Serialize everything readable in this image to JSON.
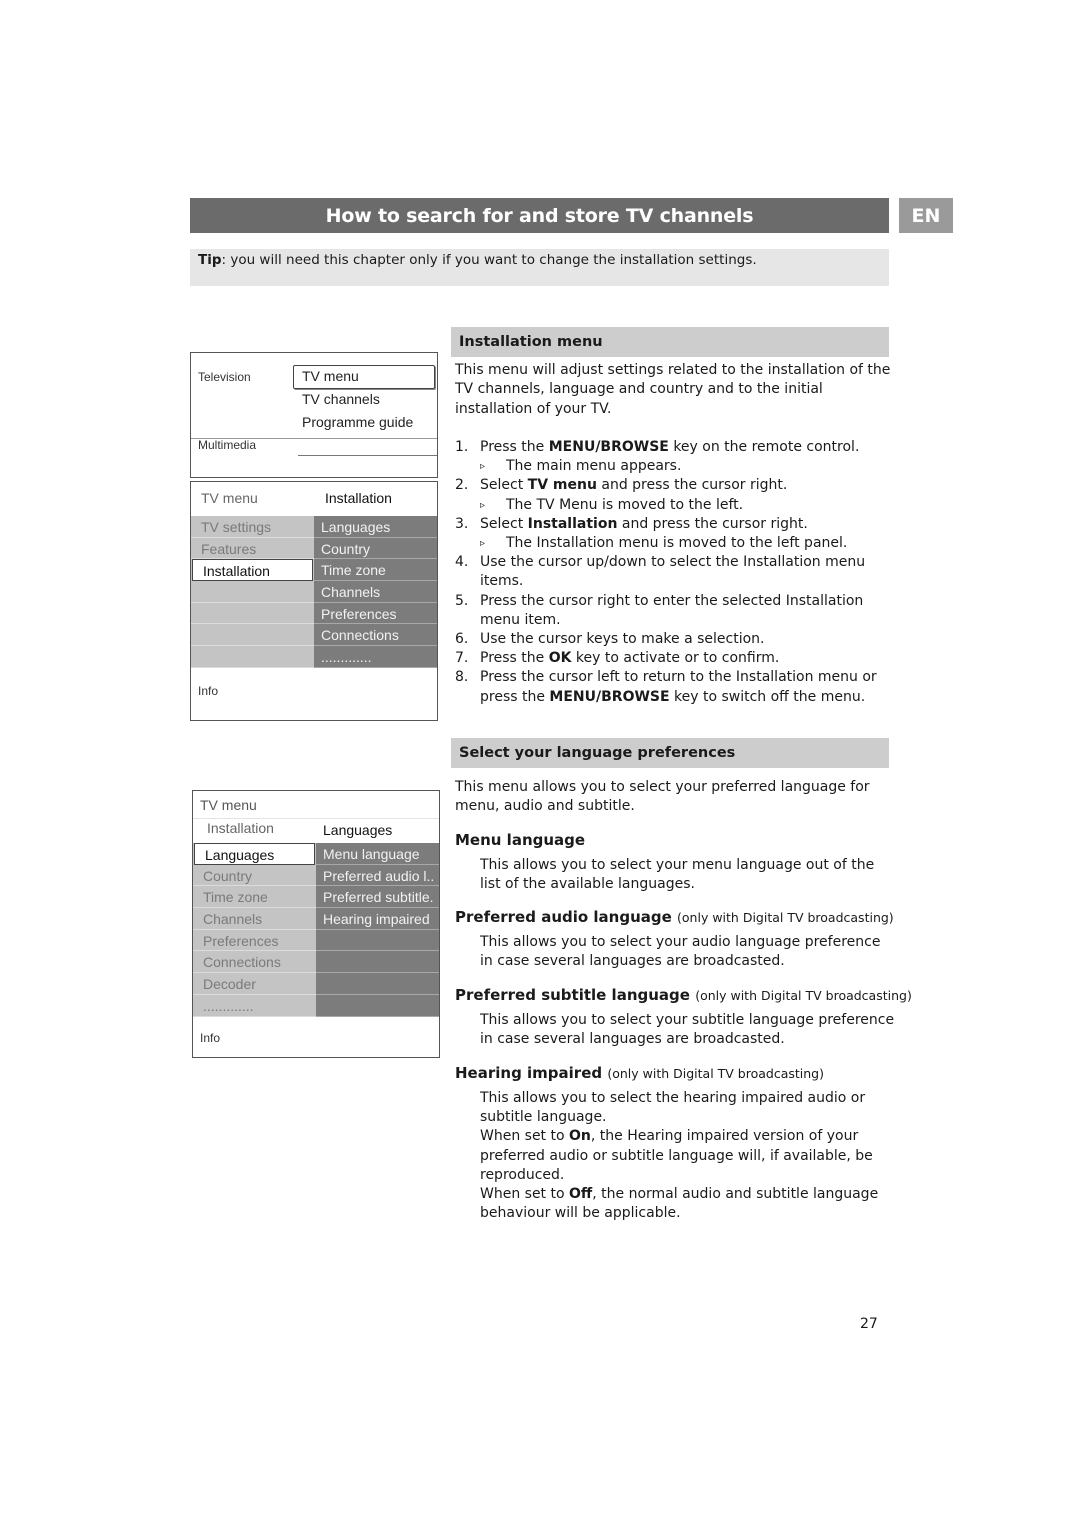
{
  "header": {
    "title": "How to search for and store TV channels",
    "lang_badge": "EN"
  },
  "tip": {
    "label": "Tip",
    "text": ": you will need this chapter only if you want to change the installation settings."
  },
  "menu_main": {
    "television_label": "Television",
    "multimedia_label": "Multimedia",
    "items": [
      "TV menu",
      "TV channels",
      "Programme guide"
    ]
  },
  "menu_installation": {
    "header_left": "TV menu",
    "header_right": "Installation",
    "left_items": [
      "TV settings",
      "Features",
      "Installation",
      "",
      "",
      "",
      ""
    ],
    "left_active": "Installation",
    "right_items": [
      "Languages",
      "Country",
      "Time zone",
      "Channels",
      "Preferences",
      "Connections",
      "............."
    ],
    "info": "Info"
  },
  "menu_languages": {
    "header_top": "TV menu",
    "header_left": "Installation",
    "header_right": "Languages",
    "left_items": [
      "Languages",
      "Country",
      "Time zone",
      "Channels",
      "Preferences",
      "Connections",
      "Decoder",
      "............."
    ],
    "left_active": "Languages",
    "right_items": [
      "Menu language",
      "Preferred audio l..",
      "Preferred subtitle.",
      "Hearing impaired",
      "",
      "",
      "",
      ""
    ],
    "info": "Info"
  },
  "installation_section": {
    "heading": "Installation menu",
    "intro": "This menu will adjust settings related to the installation of the TV channels, language and country and to the initial installation of your TV.",
    "steps": [
      {
        "num": "1.",
        "pre": "Press the ",
        "bold": "MENU/BROWSE",
        "post": " key on the remote control.",
        "result": "The main menu appears."
      },
      {
        "num": "2.",
        "pre": "Select ",
        "bold": "TV menu",
        "post": " and press the cursor right.",
        "result": "The TV Menu is moved to the left."
      },
      {
        "num": "3.",
        "pre": "Select ",
        "bold": "Installation",
        "post": " and press the cursor right.",
        "result": "The Installation menu is moved to the left panel."
      },
      {
        "num": "4.",
        "pre": "Use the cursor up/down to select the Installation menu items.",
        "bold": "",
        "post": "",
        "result": ""
      },
      {
        "num": "5.",
        "pre": "Press the cursor right to enter the selected Installation menu item.",
        "bold": "",
        "post": "",
        "result": ""
      },
      {
        "num": "6.",
        "pre": "Use the cursor keys to make a selection.",
        "bold": "",
        "post": "",
        "result": ""
      },
      {
        "num": "7.",
        "pre": "Press the ",
        "bold": "OK",
        "post": " key to activate or to confirm.",
        "result": ""
      },
      {
        "num": "8.",
        "pre": "Press the cursor left to return to the Installation menu or press the ",
        "bold": "MENU/BROWSE",
        "post": " key to switch off the menu.",
        "result": ""
      }
    ],
    "result_arrow": "▹"
  },
  "language_section": {
    "heading": "Select your language preferences",
    "intro": "This menu allows you to select your preferred language for menu, audio and subtitle.",
    "menu_language": {
      "title": "Menu language",
      "text": "This allows you to select your menu language out of the list of the available languages."
    },
    "audio_language": {
      "title": "Preferred audio language",
      "note": "(only with Digital TV broadcasting)",
      "text": "This allows you to select your audio language preference in case several languages are broadcasted."
    },
    "subtitle_language": {
      "title": "Preferred subtitle language",
      "note": "(only with Digital TV broadcasting)",
      "text": "This allows you to select your subtitle language preference in case several languages are broadcasted."
    },
    "hearing_impaired": {
      "title": "Hearing impaired",
      "note": "(only with Digital TV broadcasting)",
      "text": "This allows you to select the hearing impaired audio or subtitle language.",
      "on_pre": "When set to ",
      "on_bold": "On",
      "on_post": ", the Hearing impaired version of your preferred audio or subtitle language will, if available, be reproduced.",
      "off_pre": "When set to ",
      "off_bold": "Off",
      "off_post": ", the normal audio and subtitle language behaviour will be applicable."
    }
  },
  "page_number": "27"
}
